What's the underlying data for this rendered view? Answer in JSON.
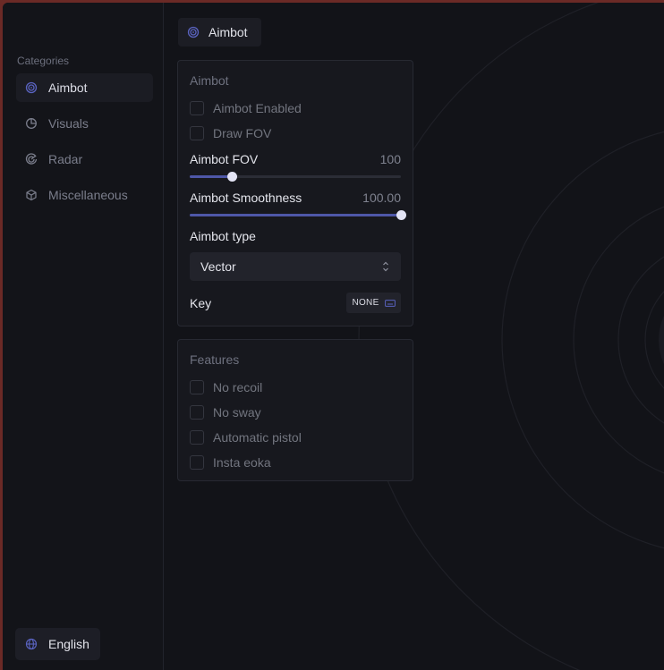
{
  "colors": {
    "accent": "#4e57a8",
    "background": "#121318",
    "panel": "#17181e",
    "frame": "#6b2a26"
  },
  "sidebar": {
    "heading": "Categories",
    "items": [
      {
        "label": "Aimbot",
        "icon": "target-icon",
        "active": true
      },
      {
        "label": "Visuals",
        "icon": "pie-chart-icon",
        "active": false
      },
      {
        "label": "Radar",
        "icon": "radar-icon",
        "active": false
      },
      {
        "label": "Miscellaneous",
        "icon": "cube-icon",
        "active": false
      }
    ],
    "language": {
      "label": "English",
      "icon": "globe-icon"
    }
  },
  "header": {
    "tab_label": "Aimbot",
    "tab_icon": "target-icon"
  },
  "aimbot_panel": {
    "title": "Aimbot",
    "checkboxes": [
      {
        "label": "Aimbot Enabled",
        "checked": false
      },
      {
        "label": "Draw FOV",
        "checked": false
      }
    ],
    "fov": {
      "label": "Aimbot FOV",
      "value": "100",
      "fraction": 0.2
    },
    "smoothness": {
      "label": "Aimbot Smoothness",
      "value": "100.00",
      "fraction": 1.0
    },
    "type": {
      "label": "Aimbot type",
      "selected": "Vector"
    },
    "key": {
      "label": "Key",
      "value": "NONE",
      "icon": "keyboard-icon"
    }
  },
  "features_panel": {
    "title": "Features",
    "checkboxes": [
      {
        "label": "No recoil",
        "checked": false
      },
      {
        "label": "No sway",
        "checked": false
      },
      {
        "label": "Automatic pistol",
        "checked": false
      },
      {
        "label": "Insta eoka",
        "checked": false
      }
    ]
  }
}
